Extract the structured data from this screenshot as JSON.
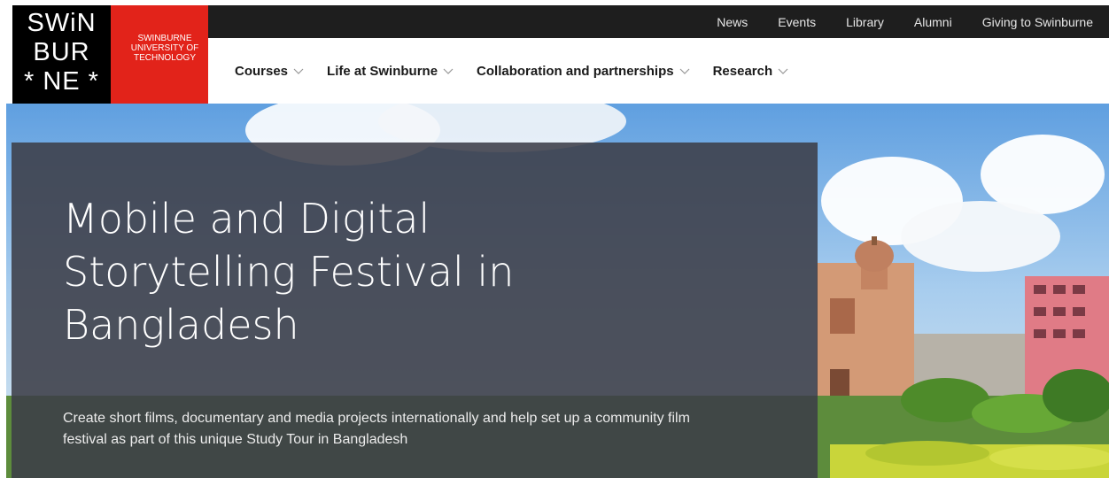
{
  "logo": {
    "wordmark_lines": [
      "SWiN",
      "BUR",
      "* NE *"
    ],
    "tagline": "SWINBURNE UNIVERSITY OF TECHNOLOGY",
    "red_hex": "#e2231a",
    "black_hex": "#000000"
  },
  "top_links": [
    "News",
    "Events",
    "Library",
    "Alumni",
    "Giving to Swinburne"
  ],
  "main_nav": [
    {
      "label": "Courses"
    },
    {
      "label": "Life at Swinburne"
    },
    {
      "label": "Collaboration and partnerships"
    },
    {
      "label": "Research"
    }
  ],
  "hero": {
    "title_lines": [
      "Mobile and Digital",
      "Storytelling Festival in",
      "Bangladesh"
    ],
    "description": "Create short films, documentary and media projects internationally and help set up a community film festival as part of this unique Study Tour in Bangladesh",
    "panel_hex": "#3c3e48"
  }
}
